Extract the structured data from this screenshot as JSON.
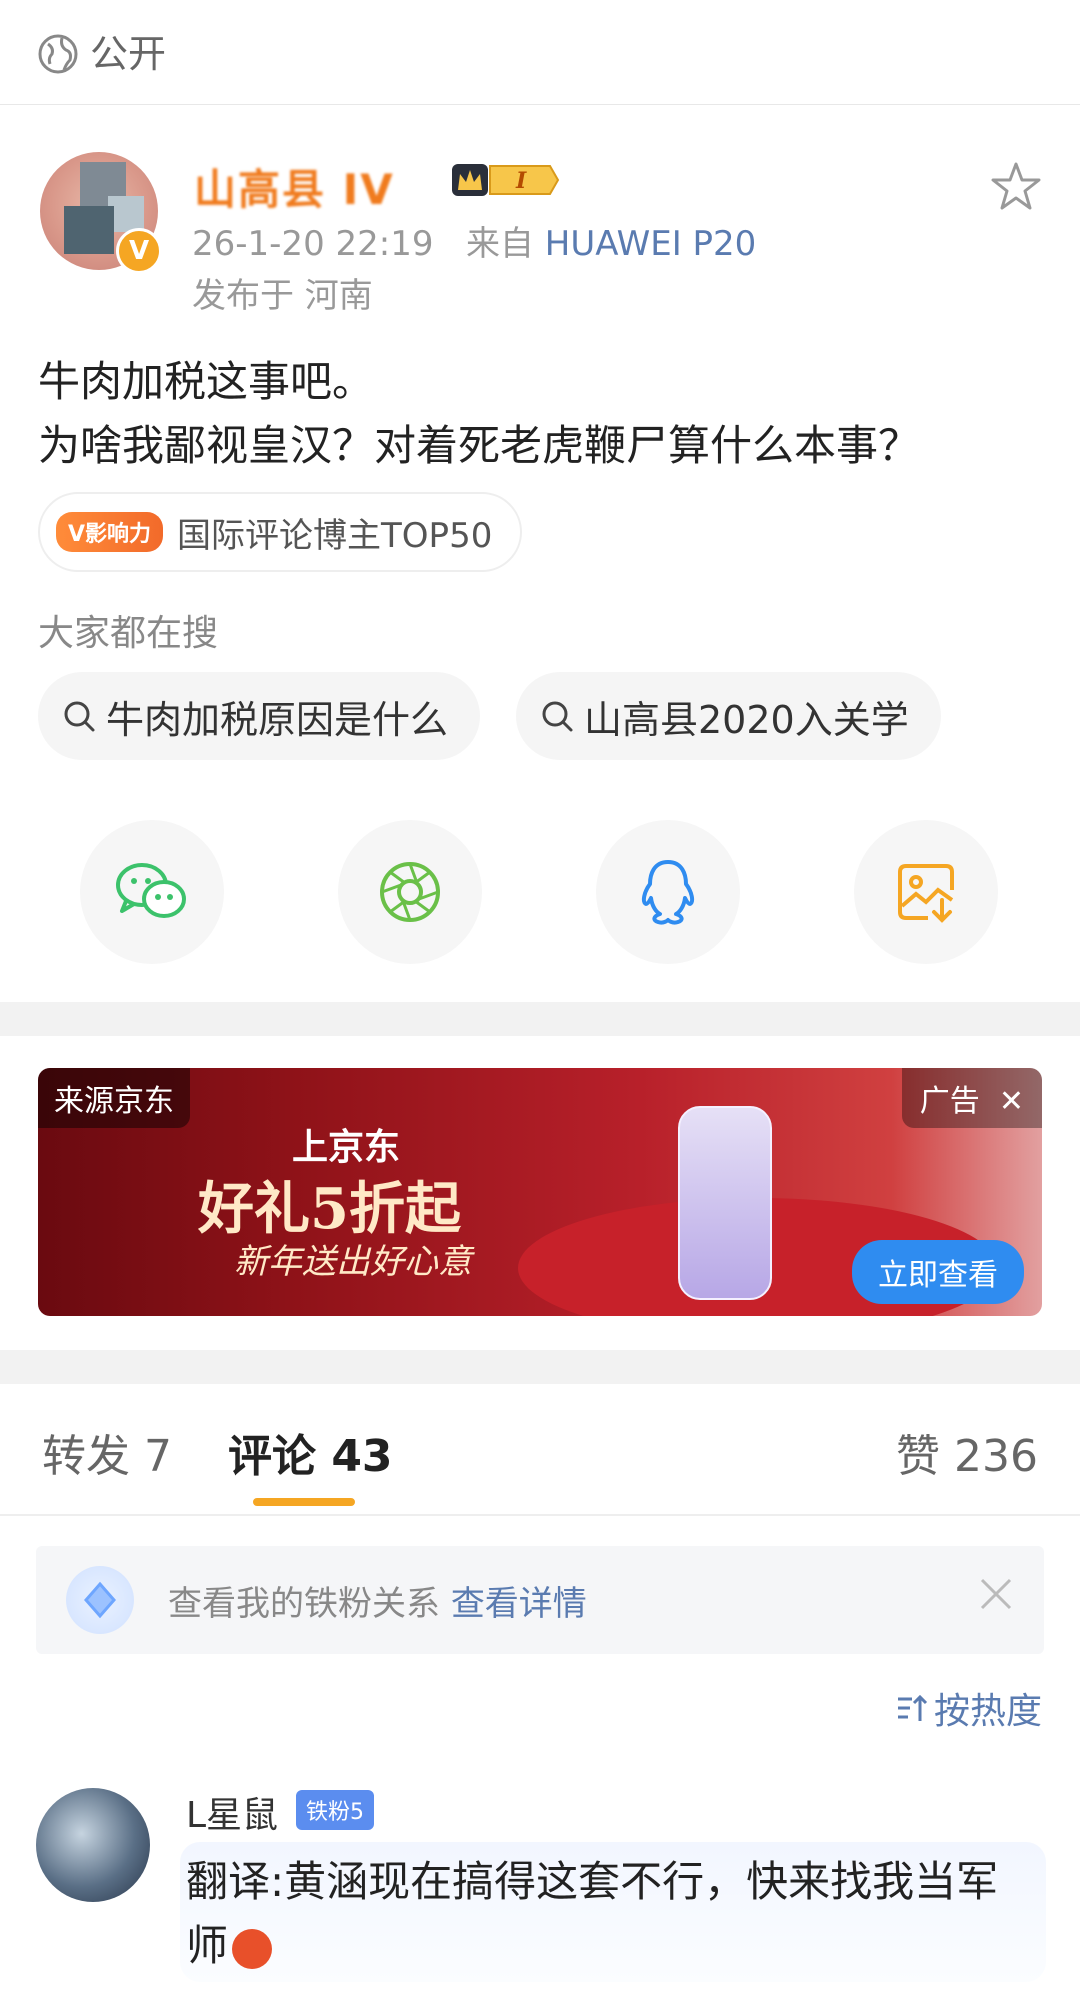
{
  "visibility": {
    "label": "公开",
    "icon": "globe-icon"
  },
  "post": {
    "username": "山高县 IV",
    "time": "26-1-20 22:19",
    "from_prefix": "来自",
    "device": "HUAWEI P20",
    "location": "发布于 河南",
    "text": "牛肉加税这事吧。\n为啥我鄙视皇汉？对着死老虎鞭尸算什么本事？",
    "influence_chip": "V影响力",
    "influence_text": "国际评论博主TOP50"
  },
  "search": {
    "title": "大家都在搜",
    "chips": [
      "牛肉加税原因是什么",
      "山高县2020入关学"
    ]
  },
  "share_icons": [
    "wechat-icon",
    "moments-icon",
    "qq-icon",
    "save-image-icon"
  ],
  "colors": {
    "accent": "#f5a623",
    "link": "#5a7bb0",
    "wechat": "#3cc26b",
    "moments": "#6ac048",
    "qq": "#2f8cf0",
    "save": "#f5a623"
  },
  "ad": {
    "source": "来源京东",
    "tag": "广告",
    "line1": "上京东",
    "line2": "好礼5折起",
    "line3": "新年送出好心意",
    "button": "立即查看"
  },
  "tabs": {
    "repost": "转发 7",
    "comment": "评论 43",
    "like": "赞 236"
  },
  "fan_bar": {
    "text": "查看我的铁粉关系",
    "link": "查看详情"
  },
  "sort": {
    "label": "按热度"
  },
  "comment": {
    "name": "L星鼠",
    "badge": "铁粉5",
    "text": "翻译:黄涵现在搞得这套不行，快来找我当军师"
  }
}
